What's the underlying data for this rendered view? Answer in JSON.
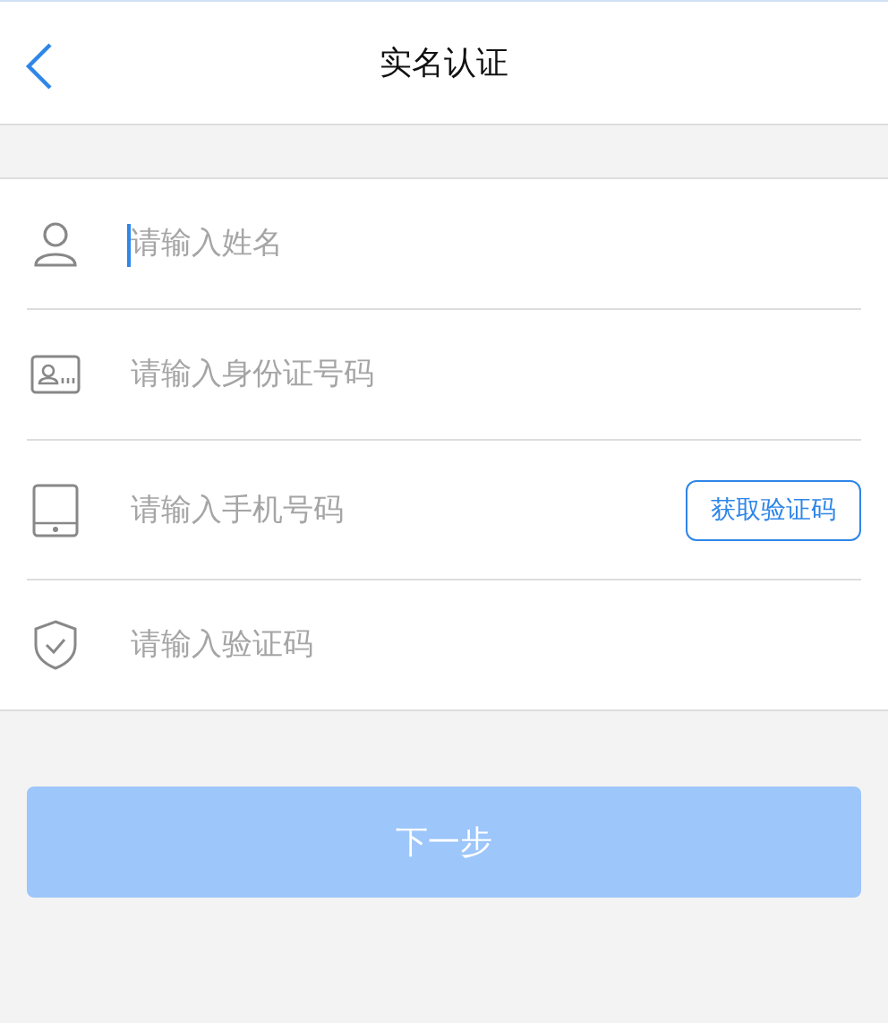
{
  "header": {
    "title": "实名认证"
  },
  "fields": [
    {
      "kind": "person",
      "placeholder": "请输入姓名",
      "focused": true
    },
    {
      "kind": "idcard",
      "placeholder": "请输入身份证号码",
      "focused": false
    },
    {
      "kind": "phone",
      "placeholder": "请输入手机号码",
      "focused": false,
      "action": "获取验证码"
    },
    {
      "kind": "shield",
      "placeholder": "请输入验证码",
      "focused": false
    }
  ],
  "next_button": {
    "label": "下一步",
    "disabled": true
  }
}
